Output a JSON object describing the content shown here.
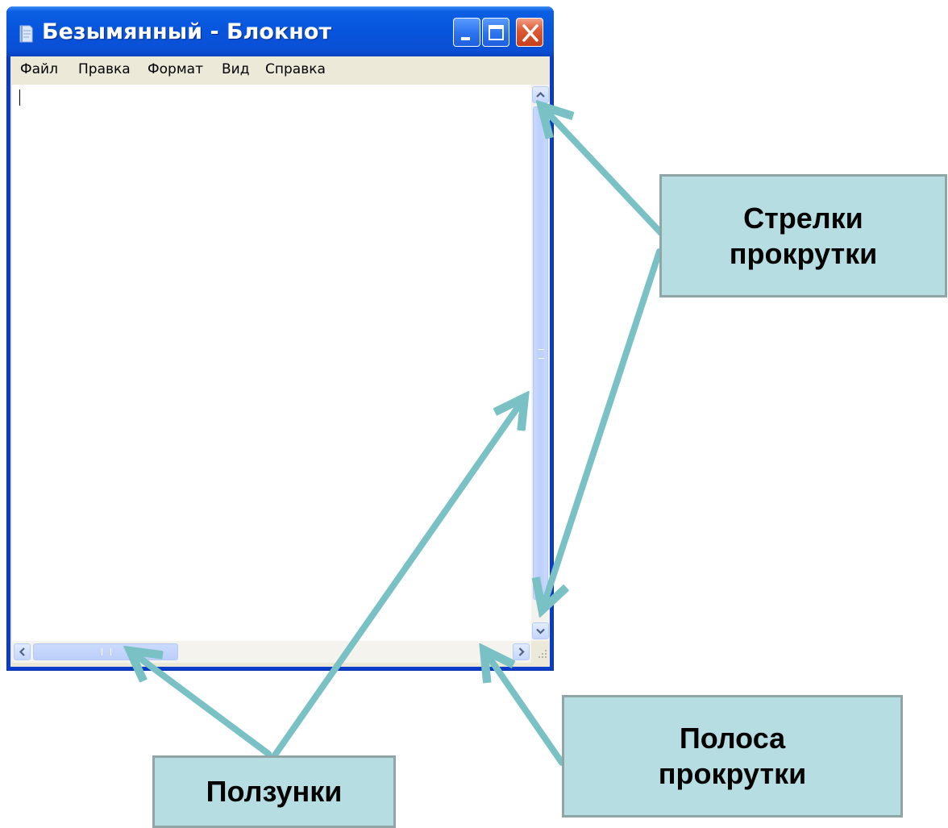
{
  "window": {
    "title": "Безымянный - Блокнот",
    "app_icon": "notepad-icon",
    "buttons": [
      "minimize-icon",
      "maximize-icon",
      "close-icon"
    ]
  },
  "menu": {
    "items": [
      "Файл",
      "Правка",
      "Формат",
      "Вид",
      "Справка"
    ]
  },
  "editor": {
    "text": ""
  },
  "scrollbars": {
    "vertical": {
      "up_icon": "chevron-up-icon",
      "down_icon": "chevron-down-icon"
    },
    "horizontal": {
      "left_icon": "chevron-left-icon",
      "right_icon": "chevron-right-icon"
    }
  },
  "callouts": {
    "scroll_arrows": [
      "Стрелки",
      "прокрутки"
    ],
    "sliders": "Ползунки",
    "scroll_bar": [
      "Полоса",
      "прокрутки"
    ]
  },
  "colors": {
    "callout_fill": "#b6dde1",
    "callout_border": "#8fa5a6",
    "pointer_arrow": "#79c1c4",
    "titlebar": "#0855dd",
    "scroll_thumb": "#c1d3fb"
  }
}
